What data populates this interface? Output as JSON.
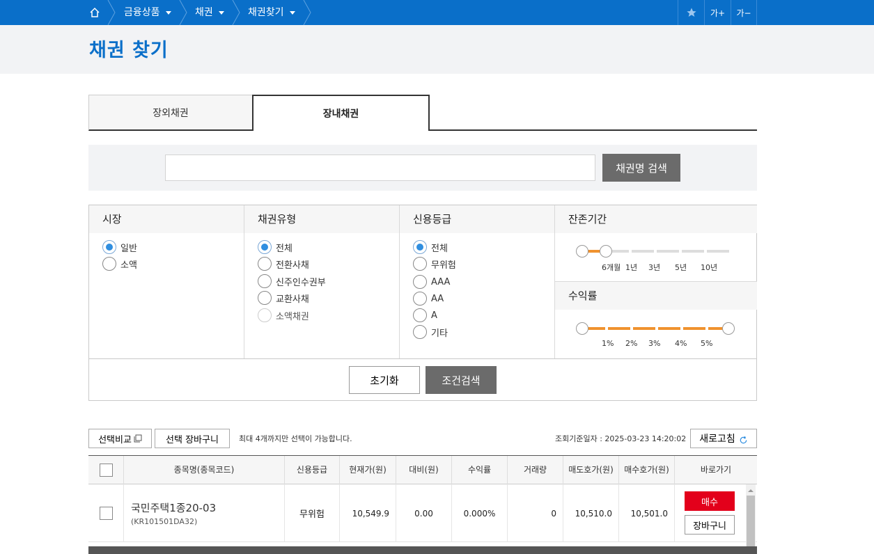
{
  "nav": {
    "crumbs": [
      "금융상품",
      "채권",
      "채권찾기"
    ],
    "favorite_icon": "star-icon",
    "font_up": "가+",
    "font_down": "가−",
    "brand_color": "#0a6fc9"
  },
  "page": {
    "title": "채권 찾기"
  },
  "tabs": [
    {
      "label": "장외채권",
      "active": false
    },
    {
      "label": "장내채권",
      "active": true
    }
  ],
  "search": {
    "value": "",
    "placeholder": "",
    "button": "채권명 검색"
  },
  "filters": {
    "market": {
      "title": "시장",
      "options": [
        "일반",
        "소액"
      ],
      "selected": "일반"
    },
    "bond_type": {
      "title": "채권유형",
      "options": [
        "전체",
        "전환사채",
        "신주인수권부",
        "교환사채",
        "소액채권"
      ],
      "selected": "전체",
      "disabled": [
        "소액채권"
      ]
    },
    "credit": {
      "title": "신용등급",
      "options": [
        "전체",
        "무위험",
        "AAA",
        "AA",
        "A",
        "기타"
      ],
      "selected": "전체"
    },
    "maturity": {
      "title": "잔존기간",
      "ticks": [
        "6개월",
        "1년",
        "3년",
        "5년",
        "10년"
      ],
      "range": [
        "",
        "6개월"
      ]
    },
    "yield": {
      "title": "수익률",
      "ticks": [
        "1%",
        "2%",
        "3%",
        "4%",
        "5%"
      ],
      "range": [
        "",
        ""
      ]
    },
    "reset": "초기화",
    "submit": "조건검색",
    "accent_color": "#f0922e"
  },
  "list": {
    "compare_btn": "선택비교",
    "cart_btn": "선택 장바구니",
    "note": "최대 4개까지만 선택이 가능합니다.",
    "query_time": "조회기준일자 : 2025-03-23 14:20:02",
    "refresh": "새로고침",
    "columns": [
      "종목명(종목코드)",
      "신용등급",
      "현재가(원)",
      "대비(원)",
      "수익률",
      "거래량",
      "매도호가(원)",
      "매수호가(원)",
      "바로가기"
    ],
    "rows": [
      {
        "name": "국민주택1종20-03",
        "code": "(KR101501DA32)",
        "credit": "무위험",
        "price": "10,549.9",
        "change": "0.00",
        "yield": "0.000%",
        "volume": "0",
        "ask": "10,510.0",
        "bid": "10,501.0",
        "buy": "매수",
        "cart": "장바구니"
      }
    ]
  }
}
